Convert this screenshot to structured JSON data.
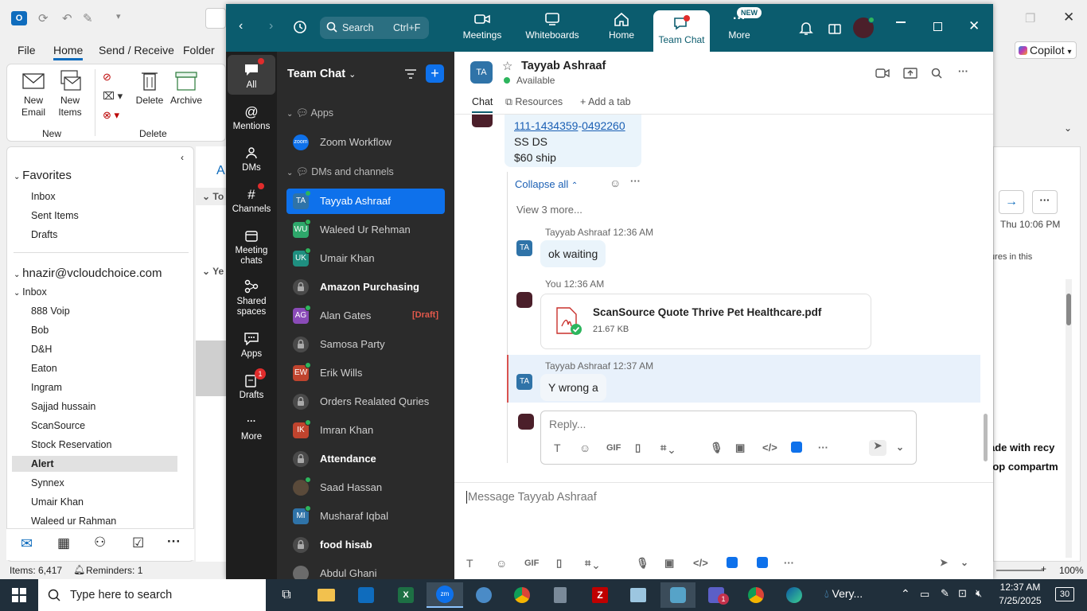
{
  "outlook": {
    "ribbon_tabs": [
      "File",
      "Home",
      "Send / Receive",
      "Folder"
    ],
    "ribbon_buttons": {
      "new_email": "New\nEmail",
      "new_items": "New\nItems",
      "delete": "Delete",
      "archive": "Archive",
      "group_new": "New",
      "group_delete": "Delete"
    },
    "copilot": "Copilot",
    "favorites_header": "Favorites",
    "favorites": [
      "Inbox",
      "Sent Items",
      "Drafts"
    ],
    "account": "hnazir@vcloudchoice.com",
    "inbox_label": "Inbox",
    "folders": [
      "888 Voip",
      "Bob",
      "D&H",
      "Eaton",
      "Ingram",
      "Sajjad hussain",
      "ScanSource",
      "Stock Reservation",
      "Alert",
      "Synnex",
      "Umair Khan",
      "Waleed ur Rahman"
    ],
    "selected_folder": "Alert",
    "status_items": "Items: 6,417",
    "status_reminders": "Reminders: 1",
    "zoom_level": "100%",
    "reading_pane_time": "Thu 10:06 PM",
    "reading_pane_text1": "tures in this",
    "reading_pane_text2": "ade with recy",
    "reading_pane_text3": "top compartm",
    "msg_list_header": "A",
    "msg_list_group1": "To",
    "msg_list_group2": "Ye"
  },
  "zoom": {
    "search_label": "Search",
    "search_shortcut": "Ctrl+F",
    "nav": {
      "meetings": "Meetings",
      "whiteboards": "Whiteboards",
      "home": "Home",
      "team_chat": "Team Chat",
      "more": "More",
      "new_badge": "NEW"
    },
    "rail": [
      "All",
      "Mentions",
      "DMs",
      "Channels",
      "Meeting chats",
      "Shared spaces",
      "Apps",
      "Drafts",
      "More"
    ],
    "drafts_badge": "1",
    "list_title": "Team Chat",
    "section_apps": "Apps",
    "app_zoom_workflow": "Zoom Workflow",
    "section_dms": "DMs and channels",
    "draft_tag": "[Draft]",
    "contacts": [
      {
        "initials": "TA",
        "name": "Tayyab Ashraaf",
        "color": "#2f73a8",
        "online": true,
        "bold": false,
        "selected": true
      },
      {
        "initials": "WU",
        "name": "Waleed Ur Rehman",
        "color": "#2ea86b",
        "online": true,
        "bold": false
      },
      {
        "initials": "UK",
        "name": "Umair Khan",
        "color": "#1f8f80",
        "online": true,
        "bold": false
      },
      {
        "initials": "",
        "name": "Amazon Purchasing",
        "color": "#444",
        "lock": true,
        "bold": true
      },
      {
        "initials": "AG",
        "name": "Alan Gates",
        "color": "#8a4bb8",
        "online": true,
        "bold": false,
        "draft": true
      },
      {
        "initials": "",
        "name": "Samosa Party",
        "color": "#444",
        "lock": true,
        "bold": false
      },
      {
        "initials": "EW",
        "name": "Erik Wills",
        "color": "#c0442e",
        "online": true,
        "bold": false
      },
      {
        "initials": "",
        "name": "Orders Realated Quries",
        "color": "#444",
        "lock": true,
        "bold": false
      },
      {
        "initials": "IK",
        "name": "Imran Khan",
        "color": "#c0442e",
        "online": true,
        "bold": false
      },
      {
        "initials": "",
        "name": "Attendance",
        "color": "#444",
        "lock": true,
        "bold": true
      },
      {
        "initials": "",
        "name": "Saad Hassan",
        "color": "#5a4a3a",
        "photo": true,
        "online": true,
        "bold": false
      },
      {
        "initials": "MI",
        "name": "Musharaf Iqbal",
        "color": "#2f73a8",
        "online": true,
        "bold": false
      },
      {
        "initials": "",
        "name": "food hisab",
        "color": "#444",
        "lock": true,
        "bold": true
      },
      {
        "initials": "",
        "name": "Abdul Ghani",
        "color": "#6b6b6b",
        "photo": true,
        "bold": false
      }
    ],
    "chat": {
      "header_initials": "TA",
      "header_name": "Tayyab Ashraaf",
      "header_status": "Available",
      "tab_chat": "Chat",
      "tab_resources": "Resources",
      "tab_add": "Add a tab",
      "prev_msg_phone_a": "111-1434359",
      "prev_msg_phone_sep": "-",
      "prev_msg_phone_b": "0492260",
      "prev_msg_line2": "SS DS",
      "prev_msg_line3": "$60 ship",
      "collapse_all": "Collapse all",
      "view_more": "View 3 more...",
      "msg1_author": "Tayyab Ashraaf 12:36 AM",
      "msg1_text": "ok waiting",
      "msg2_author": "You 12:36 AM",
      "file_name": "ScanSource Quote Thrive Pet Healthcare.pdf",
      "file_size": "21.67 KB",
      "msg3_author": "Tayyab Ashraaf 12:37 AM",
      "msg3_text": "Y wrong a",
      "reply_placeholder": "Reply...",
      "gif": "GIF",
      "message_placeholder": "Message Tayyab Ashraaf"
    }
  },
  "taskbar": {
    "search_placeholder": "Type here to search",
    "weather": "Very...",
    "time": "12:37 AM",
    "date": "7/25/2025",
    "notif_count": "30",
    "teams_badge": "1"
  }
}
